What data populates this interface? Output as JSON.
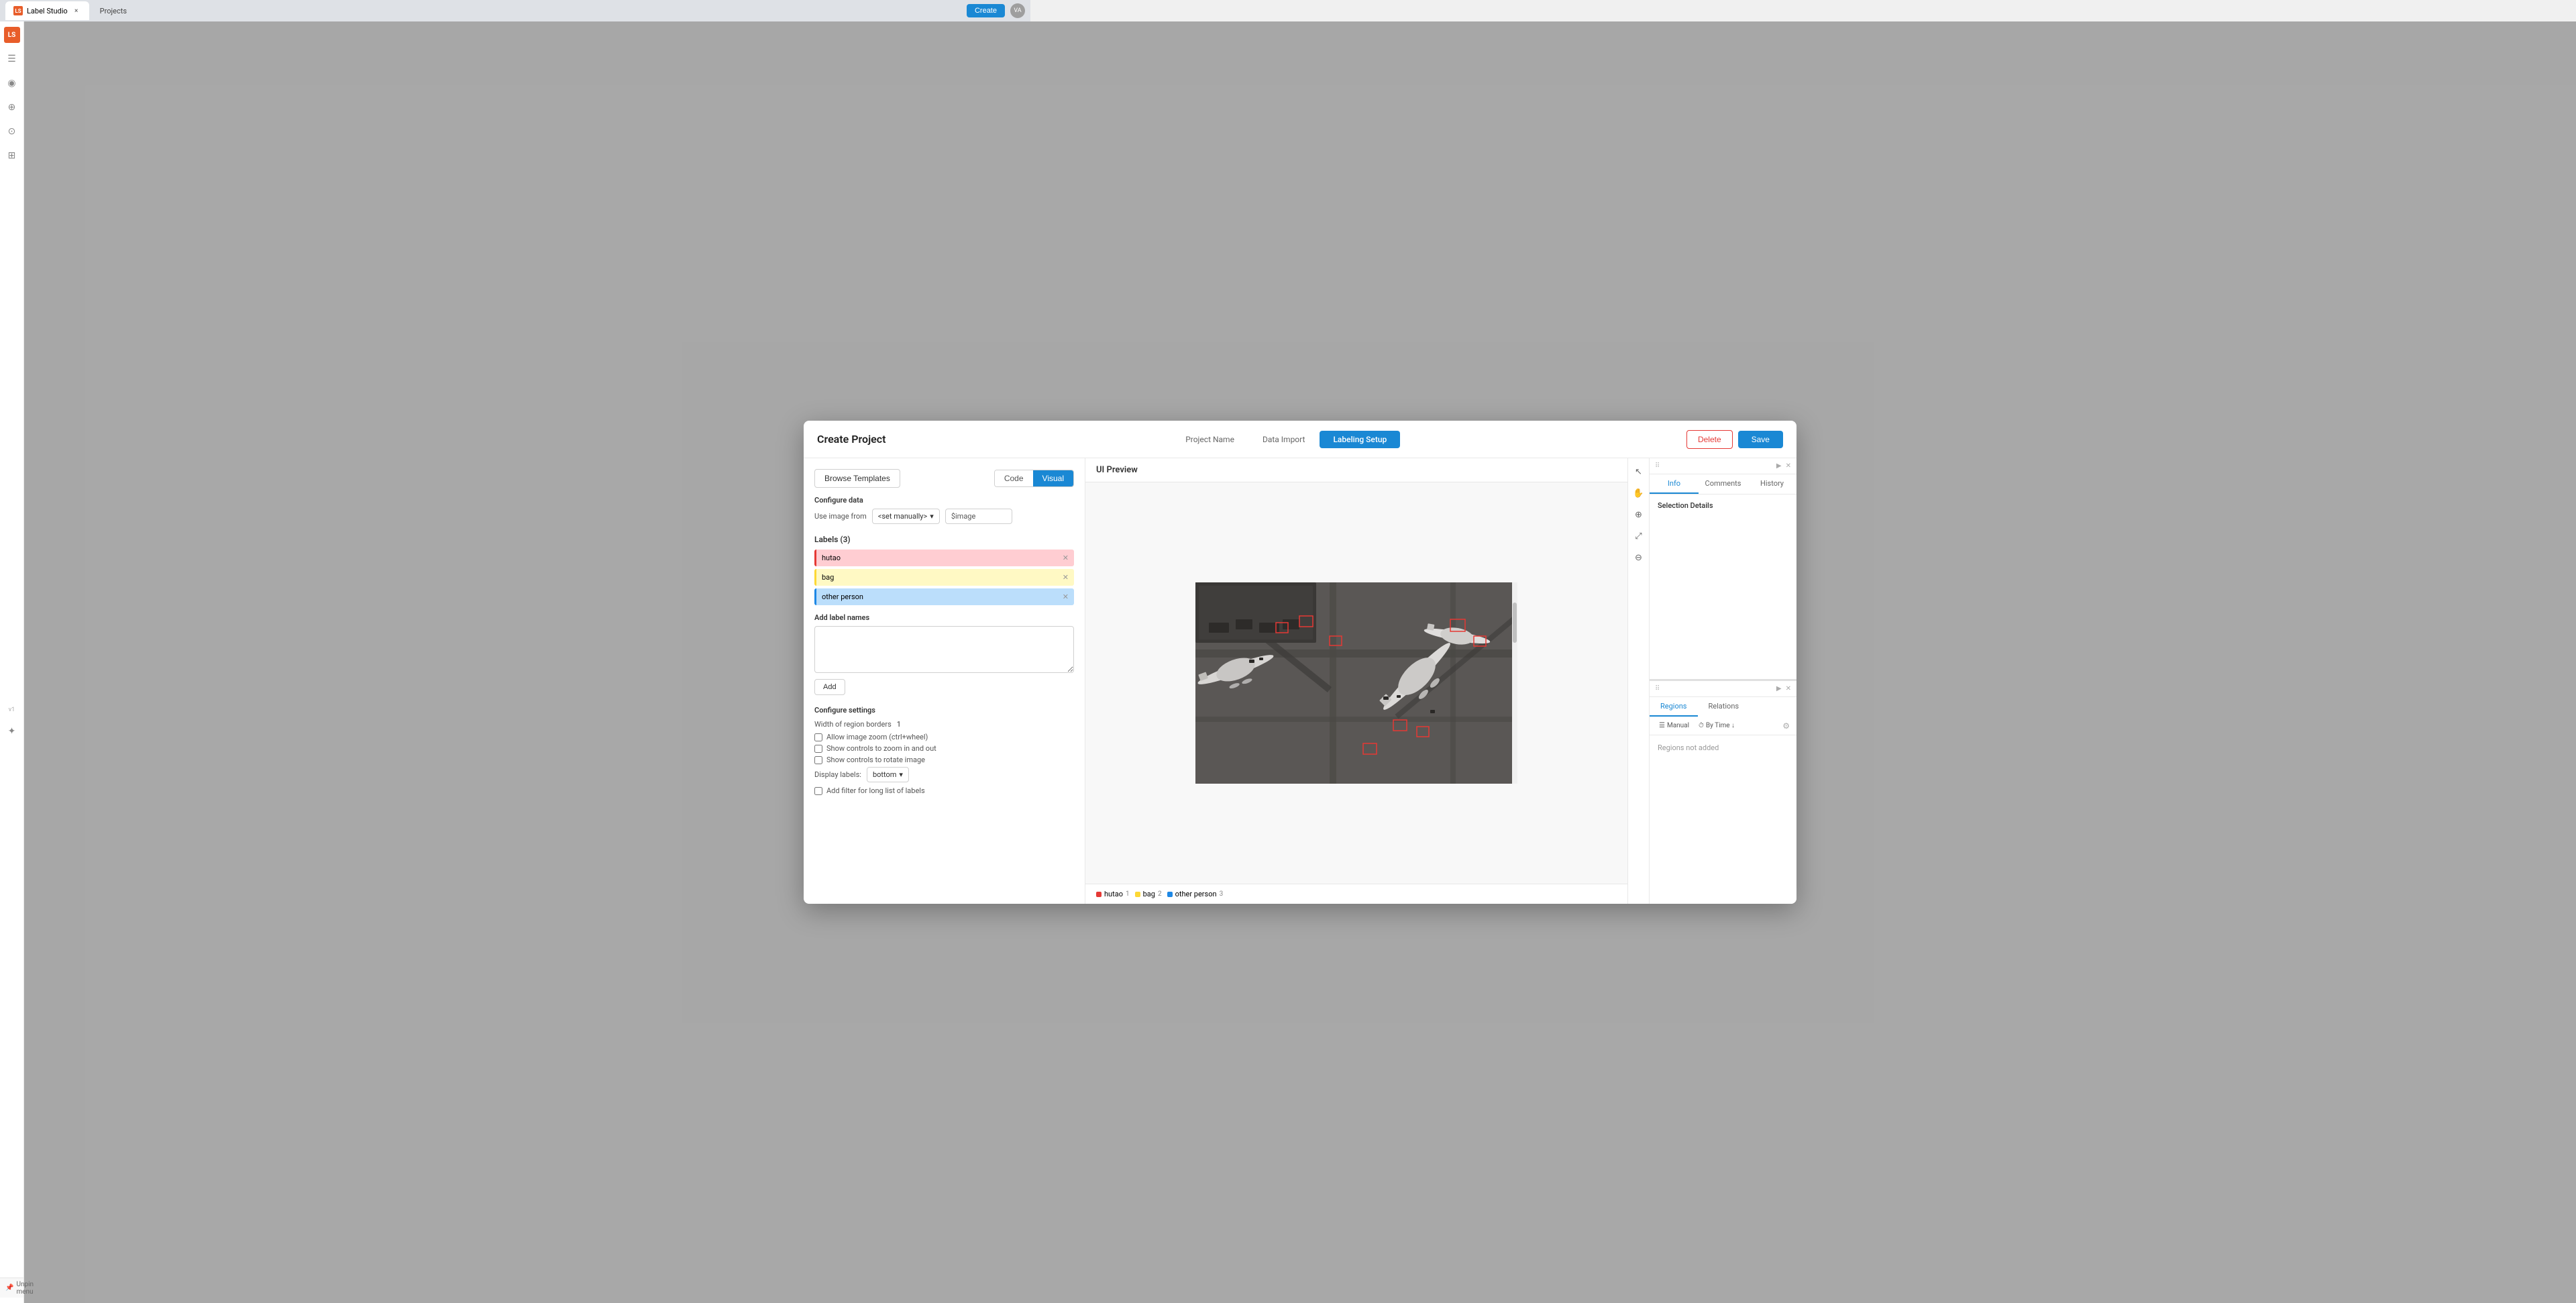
{
  "browser": {
    "tab1_label": "Label Studio",
    "tab1_close": "×",
    "tab2_label": "Projects",
    "create_btn": "Create",
    "user_initials": "VA"
  },
  "sidebar": {
    "logo_text": "LS",
    "icons": [
      "☰",
      "◉",
      "⊕",
      "⊙",
      "⊞",
      "v1"
    ]
  },
  "unpin_menu": {
    "label": "Unpin menu",
    "icon": "📌"
  },
  "modal": {
    "title": "Create Project",
    "steps": [
      {
        "id": "project-name",
        "label": "Project Name",
        "active": false
      },
      {
        "id": "data-import",
        "label": "Data Import",
        "active": false
      },
      {
        "id": "labeling-setup",
        "label": "Labeling Setup",
        "active": true
      }
    ],
    "delete_btn": "Delete",
    "save_btn": "Save"
  },
  "left_panel": {
    "browse_templates_btn": "Browse Templates",
    "toggle": {
      "code_label": "Code",
      "visual_label": "Visual"
    },
    "configure_data": {
      "section_label": "Configure data",
      "use_image_from_label": "Use image from",
      "select_value": "<set manually>",
      "input_value": "$image"
    },
    "labels_section": {
      "header": "Labels (3)",
      "add_label_names": "Add label names",
      "add_btn": "Add",
      "items": [
        {
          "id": "hutao",
          "text": "hutao",
          "color": "#ffcdd2",
          "bar_color": "#e53935"
        },
        {
          "id": "bag",
          "text": "bag",
          "color": "#fff9c4",
          "bar_color": "#fdd835"
        },
        {
          "id": "other-person",
          "text": "other person",
          "color": "#bbdefb",
          "bar_color": "#1e88e5"
        }
      ]
    },
    "configure_settings": {
      "section_label": "Configure settings",
      "width_label": "Width of region borders",
      "width_value": "1",
      "checkboxes": [
        {
          "id": "allow-zoom",
          "label": "Allow image zoom (ctrl+wheel)",
          "checked": false
        },
        {
          "id": "show-zoom-controls",
          "label": "Show controls to zoom in and out",
          "checked": false
        },
        {
          "id": "show-rotate",
          "label": "Show controls to rotate image",
          "checked": false
        }
      ],
      "display_labels_label": "Display labels:",
      "display_labels_value": "bottom",
      "filter_checkbox": {
        "label": "Add filter for long list of labels",
        "checked": false
      }
    }
  },
  "ui_preview": {
    "header": "UI Preview",
    "labels_bar": [
      {
        "id": "hutao",
        "label": "hutao",
        "count": "1",
        "color": "#e53935"
      },
      {
        "id": "bag",
        "label": "bag",
        "count": "2",
        "color": "#fdd835"
      },
      {
        "id": "other-person",
        "label": "other person",
        "count": "3",
        "color": "#1e88e5"
      }
    ]
  },
  "right_panel": {
    "top": {
      "tabs": [
        {
          "id": "info",
          "label": "Info",
          "active": true
        },
        {
          "id": "comments",
          "label": "Comments",
          "active": false
        },
        {
          "id": "history",
          "label": "History",
          "active": false
        }
      ],
      "selection_details_label": "Selection Details"
    },
    "bottom": {
      "tabs": [
        {
          "id": "regions",
          "label": "Regions",
          "active": true
        },
        {
          "id": "relations",
          "label": "Relations",
          "active": false
        }
      ],
      "manual_btn": "Manual",
      "by_time_btn": "By Time ↓",
      "regions_empty": "Regions not added"
    }
  }
}
